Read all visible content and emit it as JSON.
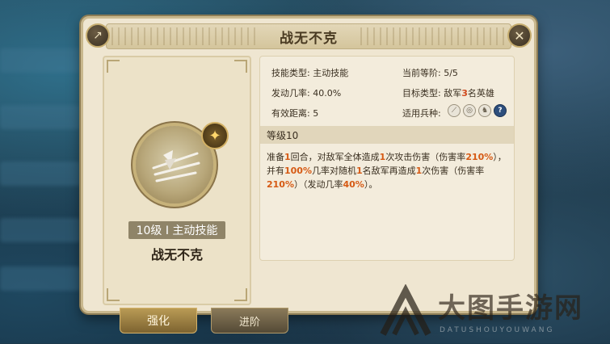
{
  "dialog": {
    "title": "战无不克",
    "close_symbol": "✕",
    "share_symbol": "↗"
  },
  "skill_card": {
    "level_badge": "10级 I 主动技能",
    "name": "战无不克",
    "icon": "halberd-icon",
    "badge_icon": "star-icon"
  },
  "info": {
    "skill_type_label": "技能类型:",
    "skill_type_value": "主动技能",
    "current_level_label": "当前等阶:",
    "current_level_value": "5/5",
    "trigger_label": "发动几率:",
    "trigger_value": "40.0%",
    "target_label": "目标类型:",
    "target_pre": "敌军",
    "target_num": "3",
    "target_post": "名英雄",
    "range_label": "有效距离:",
    "range_value": "5",
    "troop_label": "适用兵种:",
    "troop_icons": [
      "spear-icon",
      "shield-icon",
      "horse-icon",
      "question-icon"
    ],
    "troop_q": "?"
  },
  "level_section": {
    "header": "等级10",
    "desc": [
      {
        "t": "准备",
        "h": false
      },
      {
        "t": "1",
        "h": true
      },
      {
        "t": "回合，对敌军全体造成",
        "h": false
      },
      {
        "t": "1",
        "h": true
      },
      {
        "t": "次攻击伤害（伤害率",
        "h": false
      },
      {
        "t": "210%",
        "h": true
      },
      {
        "t": "），并有",
        "h": false
      },
      {
        "t": "100%",
        "h": true
      },
      {
        "t": "几率对随机",
        "h": false
      },
      {
        "t": "1",
        "h": true
      },
      {
        "t": "名敌军再造成",
        "h": false
      },
      {
        "t": "1",
        "h": true
      },
      {
        "t": "次伤害（伤害率",
        "h": false
      },
      {
        "t": "210%",
        "h": true
      },
      {
        "t": "）（发动几率",
        "h": false
      },
      {
        "t": "40%",
        "h": true
      },
      {
        "t": "）。",
        "h": false
      }
    ]
  },
  "tabs": {
    "enhance": "强化",
    "advance": "进阶"
  },
  "watermark": {
    "title": "大图手游网",
    "sub": "DATUSHOUYOUWANG"
  },
  "colors": {
    "panel": "#efe6d1",
    "highlight": "#d65a14",
    "accent_gold": "#c9a24e"
  }
}
